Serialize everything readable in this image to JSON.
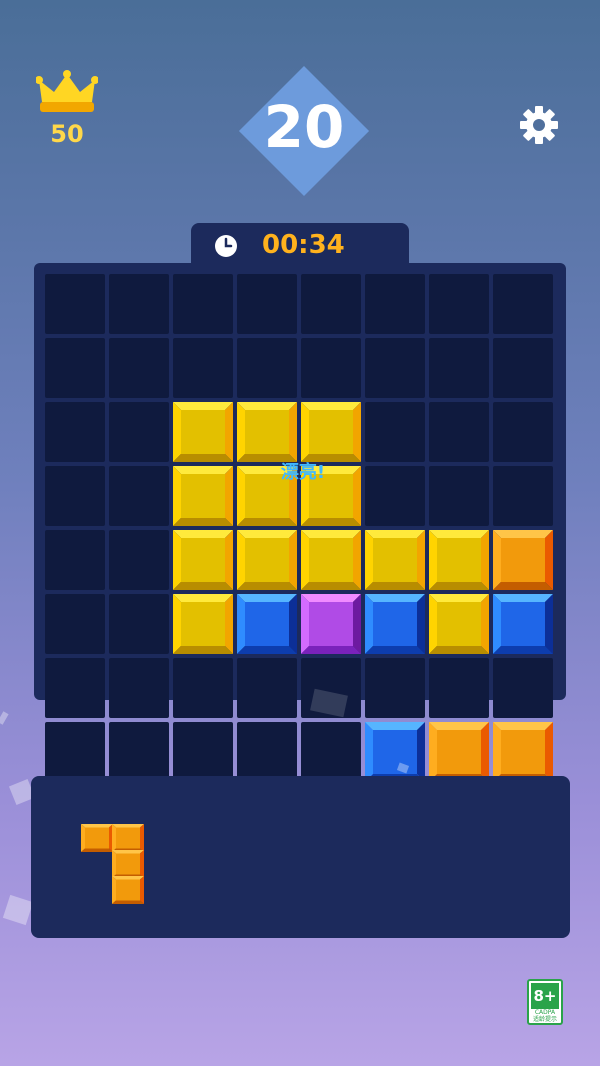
{
  "header": {
    "best_score": "50",
    "current_score": "20",
    "crown_icon": "crown-icon",
    "settings_icon": "gear-icon"
  },
  "timer": {
    "value": "00:34",
    "icon": "clock-icon"
  },
  "board": {
    "columns": 8,
    "rows": 8,
    "cells": [
      [
        null,
        null,
        null,
        null,
        null,
        null,
        null,
        null
      ],
      [
        null,
        null,
        null,
        null,
        null,
        null,
        null,
        null
      ],
      [
        null,
        null,
        "yellow",
        "yellow",
        "yellow",
        null,
        null,
        null
      ],
      [
        null,
        null,
        "yellow",
        "yellow",
        "yellow",
        null,
        null,
        null
      ],
      [
        null,
        null,
        "yellow",
        "yellow",
        "yellow",
        "yellow",
        "yellow",
        "orange"
      ],
      [
        null,
        null,
        "yellow",
        "blue",
        "purple",
        "blue",
        "yellow",
        "blue"
      ],
      [
        null,
        null,
        null,
        null,
        null,
        null,
        null,
        null
      ],
      [
        null,
        null,
        null,
        null,
        null,
        "blue",
        "orange",
        "orange"
      ]
    ],
    "combo_text": "漂亮!"
  },
  "tray": {
    "pieces": [
      {
        "color": "orange",
        "blocks": [
          [
            0,
            0
          ],
          [
            1,
            0
          ],
          [
            1,
            1
          ],
          [
            1,
            2
          ]
        ]
      }
    ]
  },
  "age_rating": {
    "label": "8+",
    "org": "CADPA",
    "note": "适龄提示"
  },
  "colors": {
    "yellow": [
      "#ffea3c",
      "#e3c000",
      "#b88d00",
      "#ffd400",
      "#f2a500"
    ],
    "orange": [
      "#ffc548",
      "#f29a0c",
      "#c45d00",
      "#ffad1f",
      "#ea5a00"
    ],
    "blue": [
      "#56b5ff",
      "#1f66e8",
      "#0d3dae",
      "#2f8cff",
      "#0c2f98"
    ],
    "purple": [
      "#f08bff",
      "#b04be6",
      "#7a22bb",
      "#d36bff",
      "#6d1aa0"
    ]
  }
}
